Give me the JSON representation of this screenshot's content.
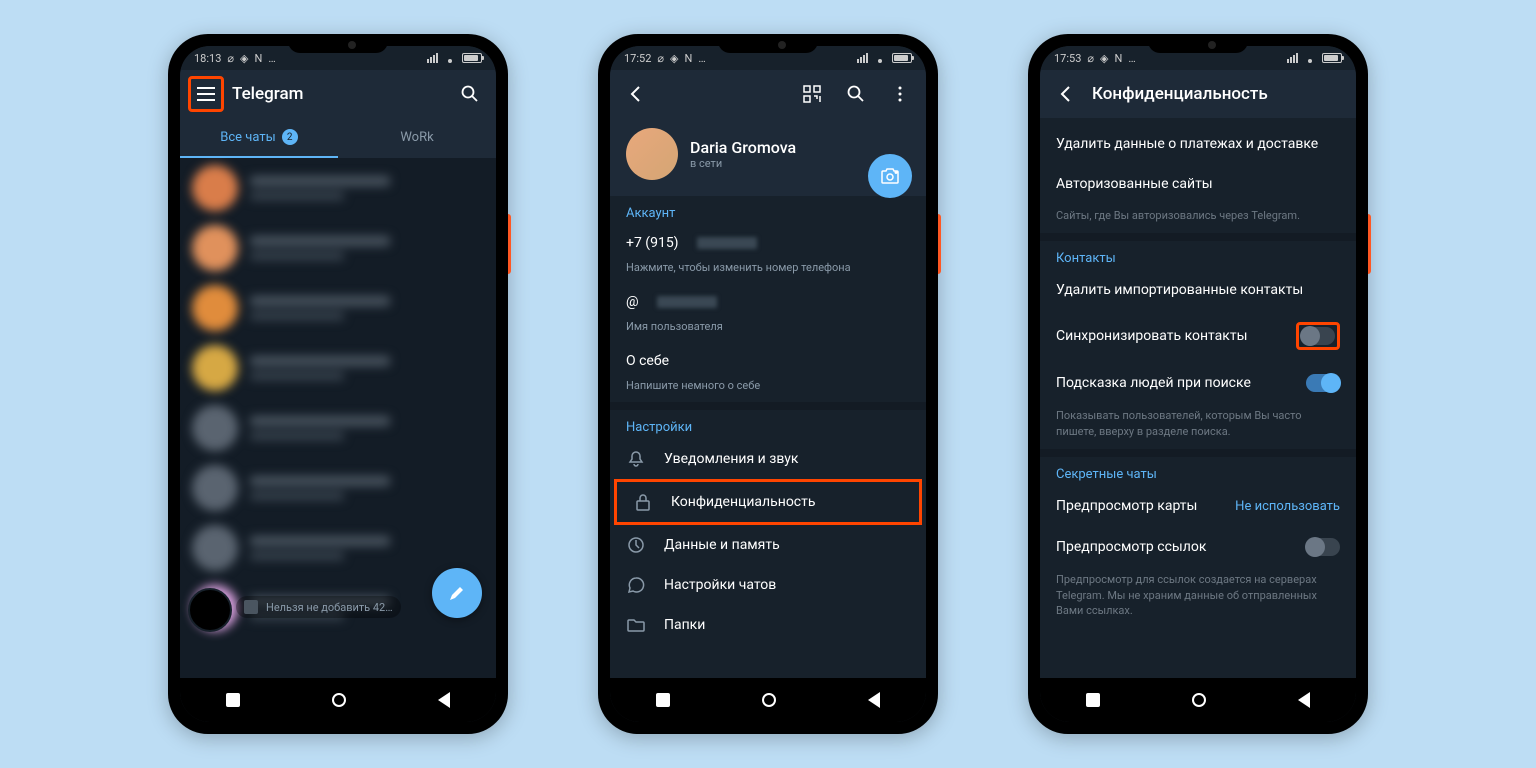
{
  "statusbar": {
    "time1": "18:13",
    "time2": "17:52",
    "time3": "17:53",
    "batt": "85"
  },
  "screen1": {
    "title": "Telegram",
    "tab_all": "Все чаты",
    "tab_all_badge": "2",
    "tab_work": "WoRk",
    "hint": "Нельзя не добавить 42…",
    "avatars": [
      "#d97d4a",
      "#e0915c",
      "#e08c3c",
      "#e08c3c",
      "#d6a844",
      "#5a6470",
      "#5a6470",
      "#5a6470",
      "#d8a0de"
    ]
  },
  "screen2": {
    "profile_name": "Daria Gromova",
    "profile_status": "в сети",
    "section_account": "Аккаунт",
    "phone": "+7 (915)",
    "phone_hint": "Нажмите, чтобы изменить номер телефона",
    "username_prefix": "@",
    "username_hint": "Имя пользователя",
    "about": "О себе",
    "about_hint": "Напишите немного о себе",
    "section_settings": "Настройки",
    "notif": "Уведомления и звук",
    "privacy": "Конфиденциальность",
    "data": "Данные и память",
    "chat": "Настройки чатов",
    "folders": "Папки"
  },
  "screen3": {
    "title": "Конфиденциальность",
    "payments": "Удалить данные о платежах и доставке",
    "auth_sites": "Авторизованные сайты",
    "auth_hint": "Сайты, где Вы авторизовались через Telegram.",
    "section_contacts": "Контакты",
    "del_contacts": "Удалить импортированные контакты",
    "sync": "Синхронизировать контакты",
    "suggest": "Подсказка людей при поиске",
    "suggest_hint": "Показывать пользователей, которым Вы часто пишете, вверху в разделе поиска.",
    "section_secret": "Секретные чаты",
    "map_preview": "Предпросмотр карты",
    "map_value": "Не использовать",
    "link_preview": "Предпросмотр ссылок",
    "link_hint": "Предпросмотр для ссылок создается на серверах Telegram. Мы не храним данные об отправленных Вами ссылках."
  }
}
